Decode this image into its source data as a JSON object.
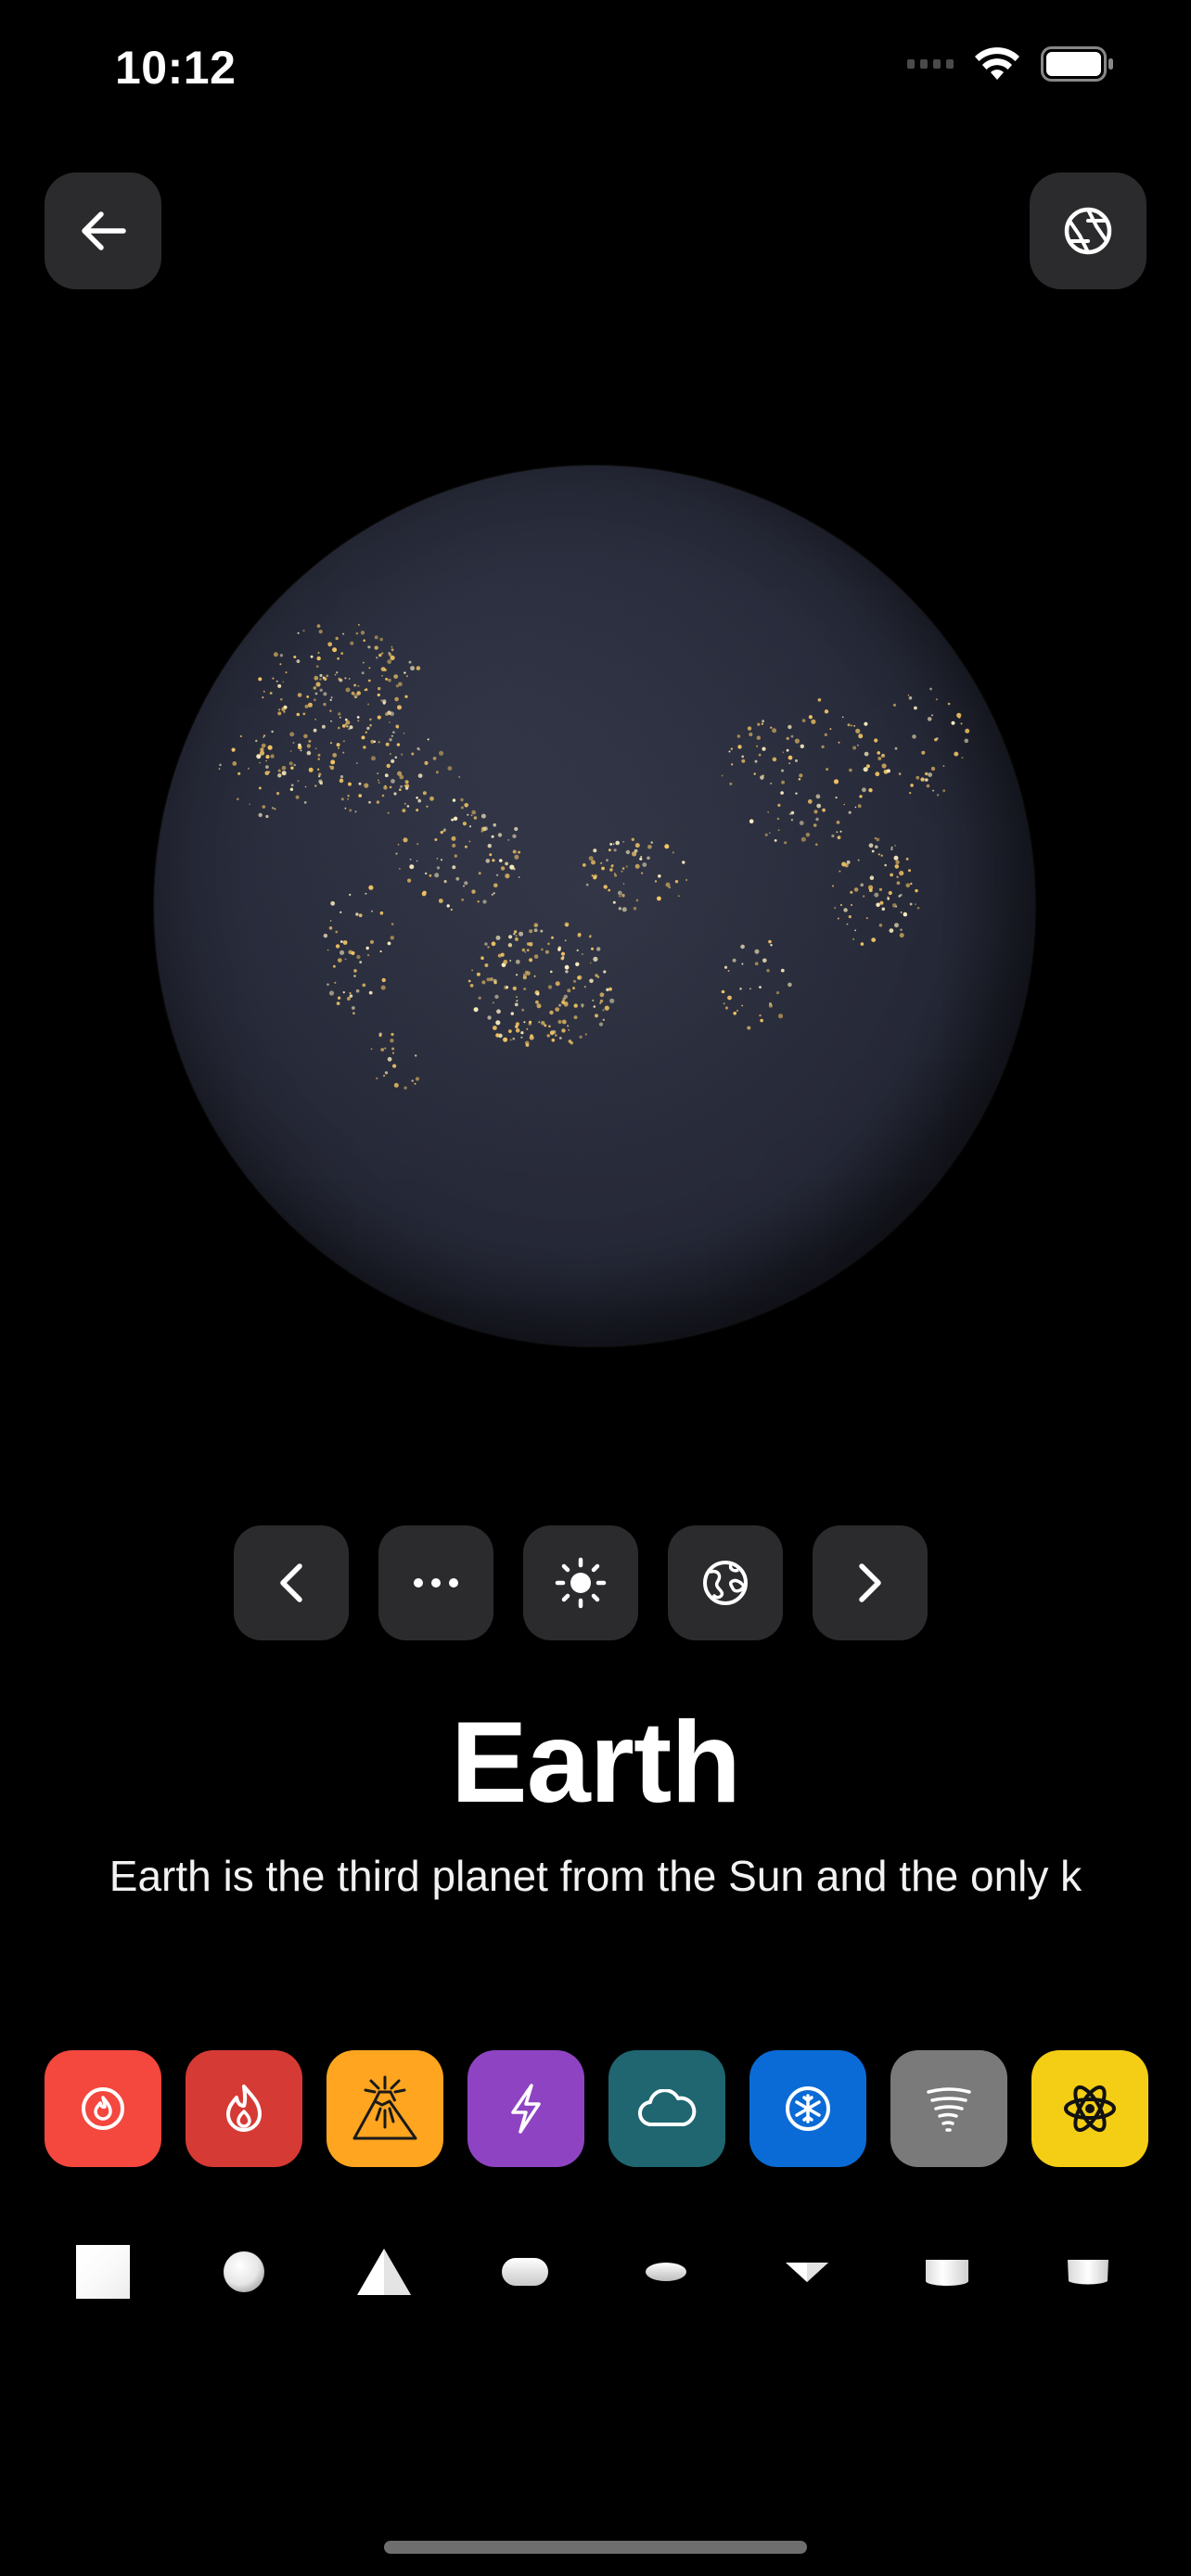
{
  "status_bar": {
    "time": "10:12",
    "icons": [
      "cellular-signal-icon",
      "wifi-icon",
      "battery-icon"
    ]
  },
  "header": {
    "back_icon": "arrow-left-icon",
    "camera_icon": "aperture-icon"
  },
  "controls": {
    "buttons": [
      {
        "name": "previous-button",
        "icon": "chevron-left-icon"
      },
      {
        "name": "more-button",
        "icon": "ellipsis-icon"
      },
      {
        "name": "brightness-button",
        "icon": "sun-icon"
      },
      {
        "name": "globe-button",
        "icon": "globe-icon"
      },
      {
        "name": "next-button",
        "icon": "chevron-right-icon"
      }
    ]
  },
  "planet": {
    "name": "Earth",
    "description": "Earth is the third planet from the Sun and the only k"
  },
  "tools": [
    {
      "name": "fire-ring-tool",
      "icon": "flame-circle-icon",
      "color": "#F4473E"
    },
    {
      "name": "fire-tool",
      "icon": "flame-icon",
      "color": "#D63A34"
    },
    {
      "name": "volcano-tool",
      "icon": "volcano-icon",
      "color": "#FFA51F"
    },
    {
      "name": "lightning-tool",
      "icon": "bolt-icon",
      "color": "#8E44C2"
    },
    {
      "name": "cloud-tool",
      "icon": "cloud-icon",
      "color": "#1F6670"
    },
    {
      "name": "snow-tool",
      "icon": "snowflake-icon",
      "color": "#0A6BD6"
    },
    {
      "name": "tornado-tool",
      "icon": "tornado-icon",
      "color": "#7A7A7A"
    },
    {
      "name": "atom-tool",
      "icon": "atom-icon",
      "color": "#F4CE14"
    }
  ],
  "shapes": [
    "cube",
    "sphere",
    "pyramid",
    "capsule",
    "ellipsoid",
    "cone",
    "cylinder",
    "tube"
  ]
}
